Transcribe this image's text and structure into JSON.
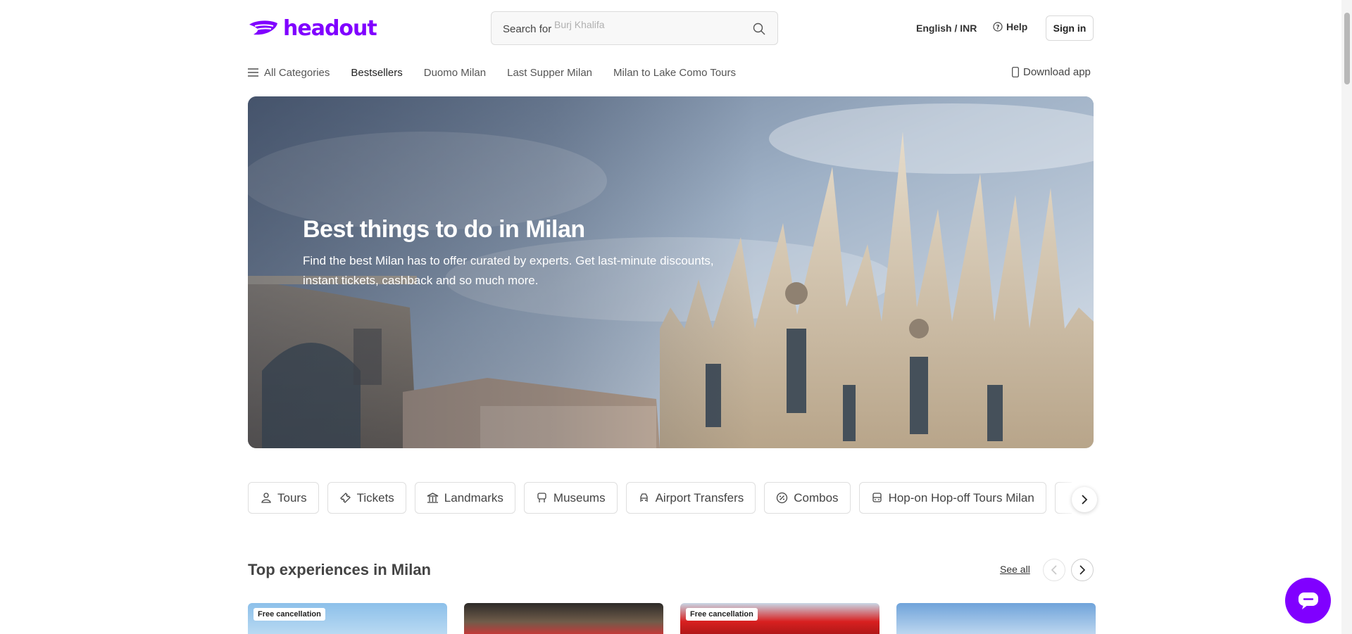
{
  "brand": {
    "name": "headout",
    "color": "#8000ff"
  },
  "header": {
    "search_label": "Search for",
    "search_hint": "Burj Khalifa",
    "language": "English / INR",
    "help": "Help",
    "sign_in": "Sign in"
  },
  "nav": {
    "all_categories": "All Categories",
    "items": [
      "Bestsellers",
      "Duomo Milan",
      "Last Supper Milan",
      "Milan to Lake Como Tours"
    ],
    "download": "Download app"
  },
  "hero": {
    "title": "Best things to do in Milan",
    "subtitle": "Find the best Milan has to offer curated by experts. Get last-minute discounts, instant tickets, cashback and so much more."
  },
  "categories": [
    {
      "label": "Tours",
      "icon": "tour-guide-icon"
    },
    {
      "label": "Tickets",
      "icon": "ticket-icon"
    },
    {
      "label": "Landmarks",
      "icon": "landmark-icon"
    },
    {
      "label": "Museums",
      "icon": "museum-icon"
    },
    {
      "label": "Airport Transfers",
      "icon": "transfer-icon"
    },
    {
      "label": "Combos",
      "icon": "combo-badge-icon"
    },
    {
      "label": "Hop-on Hop-off Tours Milan",
      "icon": "bus-icon"
    }
  ],
  "section": {
    "title": "Top experiences in Milan",
    "see_all": "See all"
  },
  "cards": [
    {
      "badge": "Free cancellation"
    },
    {
      "badge": ""
    },
    {
      "badge": "Free cancellation"
    },
    {
      "badge": ""
    }
  ]
}
